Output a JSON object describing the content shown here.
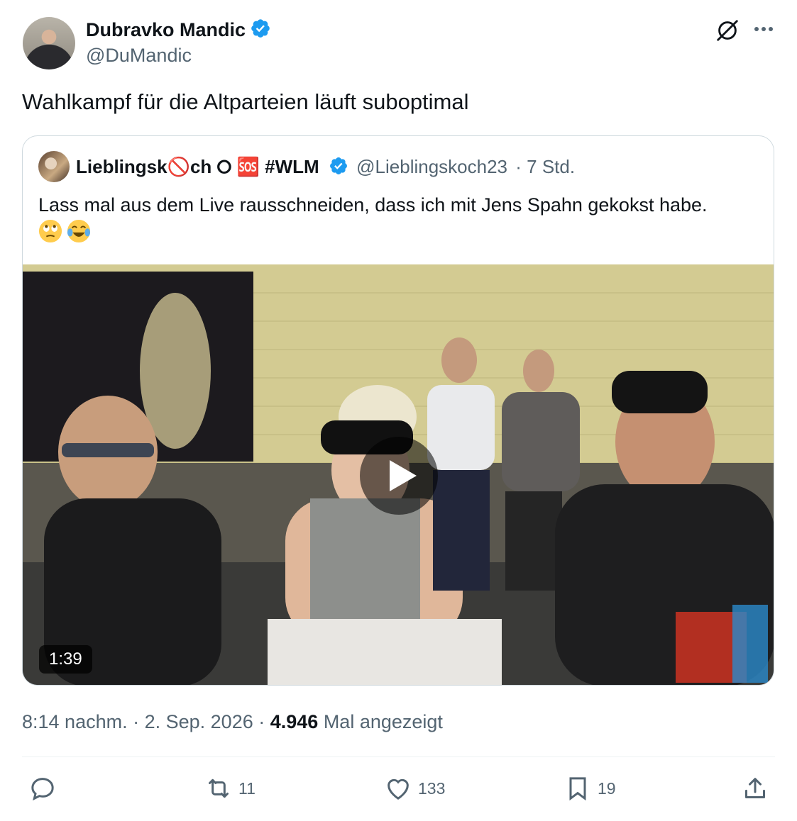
{
  "author": {
    "name": "Dubravko Mandic",
    "handle": "@DuMandic",
    "verified": true
  },
  "tweet": {
    "text": "Wahlkampf für die Altparteien läuft suboptimal"
  },
  "quoted": {
    "name": "Lieblingsk🚫️ch ⭘ 🆘 #WLM",
    "handle": "@Lieblingskoch23",
    "time": "· 7 Std.",
    "text": "Lass mal aus dem Live rausschneiden, dass ich mit Jens Spahn gekokst habe.",
    "emojis": [
      "rolling-eyes-emoji",
      "crying-laughing-emoji"
    ],
    "video": {
      "duration": "1:39"
    }
  },
  "meta": {
    "time": "8:14 nachm.",
    "sep1": " · ",
    "date": "2. Sep. 2026",
    "sep2": " · ",
    "views": "4.946",
    "views_label": " Mal angezeigt"
  },
  "actions": {
    "reply": "",
    "retweet": "11",
    "like": "133",
    "bookmark": "19"
  },
  "colors": {
    "verified": "#1d9bf0",
    "text": "#0f1419",
    "secondary": "#536471",
    "border": "#cfd9de"
  }
}
